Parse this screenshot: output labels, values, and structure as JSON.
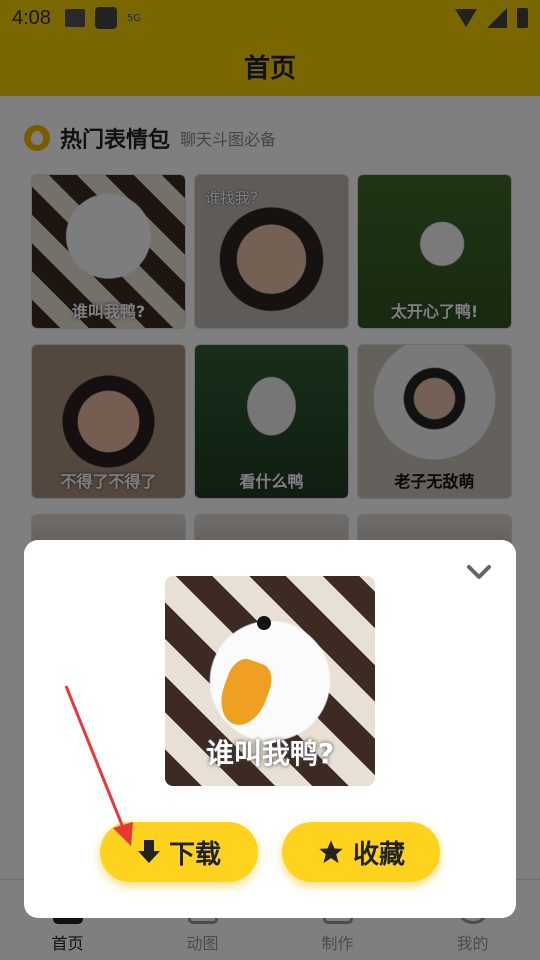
{
  "status_bar": {
    "time": "4:08",
    "network": "5G"
  },
  "header": {
    "title": "首页"
  },
  "section": {
    "title": "热门表情包",
    "subtitle": "聊天斗图必备"
  },
  "grid_items": [
    {
      "caption": "谁叫我鸭?",
      "top_caption": ""
    },
    {
      "caption": "",
      "top_caption": "谁找我？"
    },
    {
      "caption": "太开心了鸭!",
      "top_caption": ""
    },
    {
      "caption": "不得了不得了",
      "top_caption": ""
    },
    {
      "caption": "看什么鸭",
      "top_caption": ""
    },
    {
      "caption": "老子无敌萌",
      "top_caption": ""
    },
    {
      "caption": "",
      "top_caption": ""
    },
    {
      "caption": "",
      "top_caption": ""
    },
    {
      "caption": "",
      "top_caption": ""
    }
  ],
  "dialog": {
    "preview_caption": "谁叫我鸭?",
    "download_label": "下载",
    "favorite_label": "收藏"
  },
  "tabs": [
    {
      "label": "首页",
      "active": true
    },
    {
      "label": "动图",
      "active": false
    },
    {
      "label": "制作",
      "active": false
    },
    {
      "label": "我的",
      "active": false
    }
  ],
  "colors": {
    "brand": "#F5CE00",
    "button": "#FFD21E",
    "annotation": "#E53935"
  }
}
